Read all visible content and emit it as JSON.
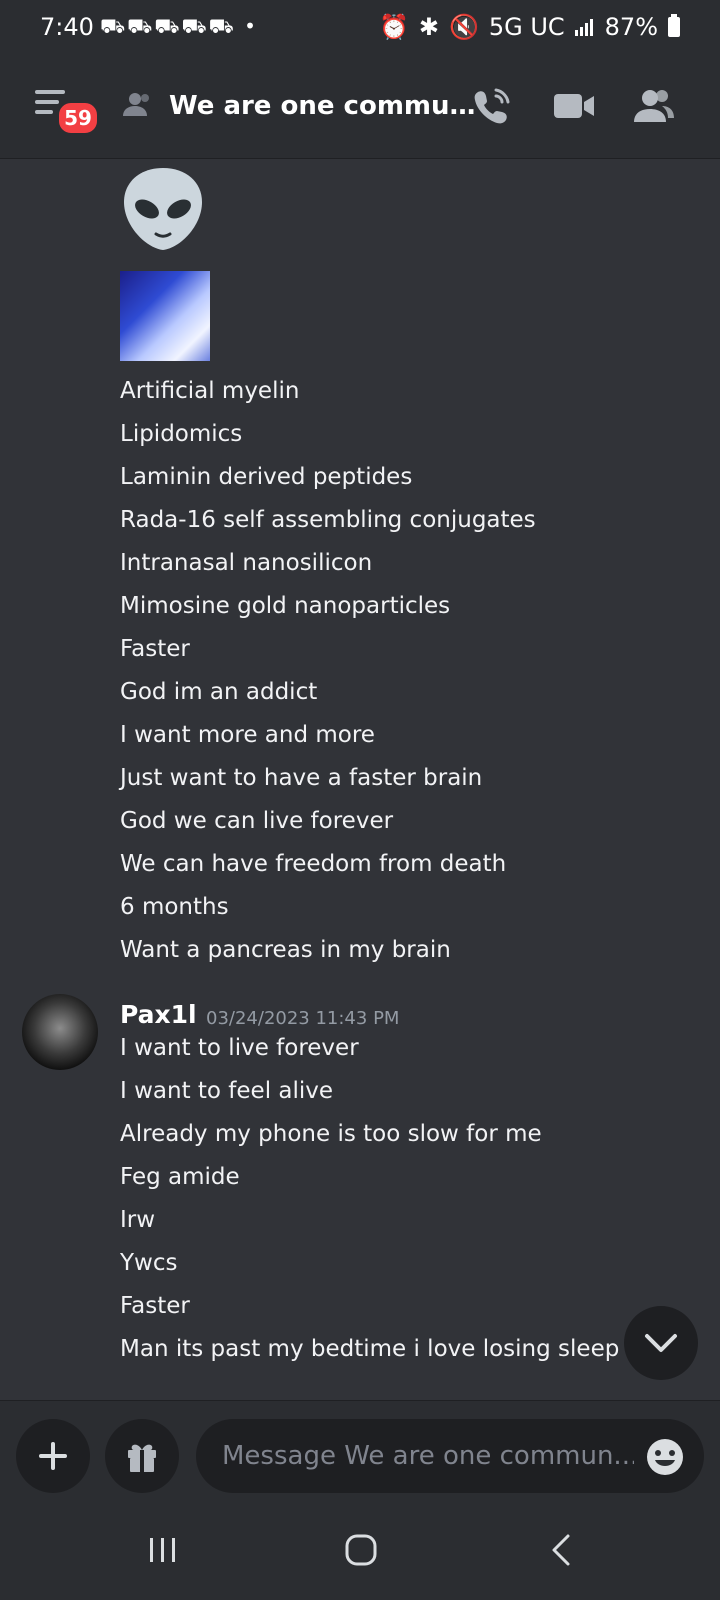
{
  "status_bar": {
    "time": "7:40",
    "notification_icons": "⛟⛟⛟⛟⛟ •",
    "network": "5G UC",
    "battery": "87%"
  },
  "header": {
    "badge_count": "59",
    "channel_name": "We are one commu…"
  },
  "messages": {
    "lines_top": [
      "Artificial myelin",
      "Lipidomics",
      "Laminin derived peptides",
      "Rada-16 self assembling conjugates",
      "Intranasal nanosilicon",
      "Mimosine gold nanoparticles",
      "Faster",
      "God im an addict",
      "I want more and more",
      "Just want to have a faster brain",
      "God we can live forever",
      "We can have freedom from death",
      "6 months",
      "Want a pancreas in my brain"
    ],
    "author": "Pax1l",
    "timestamp": "03/24/2023 11:43 PM",
    "lines_author": [
      "I want to live forever",
      "I want to feel alive",
      "Already my phone is too slow for me",
      "Feg amide",
      "Irw",
      "Ywcs",
      "Faster",
      "Man its past my bedtime i love losing sleep"
    ]
  },
  "composer": {
    "placeholder": "Message We are one commun..."
  },
  "colors": {
    "background": "#313338",
    "header": "#2b2d31",
    "input": "#1e1f22",
    "badge": "#f23f43",
    "muted": "#949ba4"
  },
  "icons": [
    "menu-icon",
    "members-icon",
    "call-icon",
    "video-icon",
    "member-list-icon",
    "alien-emoji",
    "chevron-down-icon",
    "plus-icon",
    "gift-icon",
    "emoji-icon",
    "recents-icon",
    "home-icon",
    "back-icon"
  ]
}
